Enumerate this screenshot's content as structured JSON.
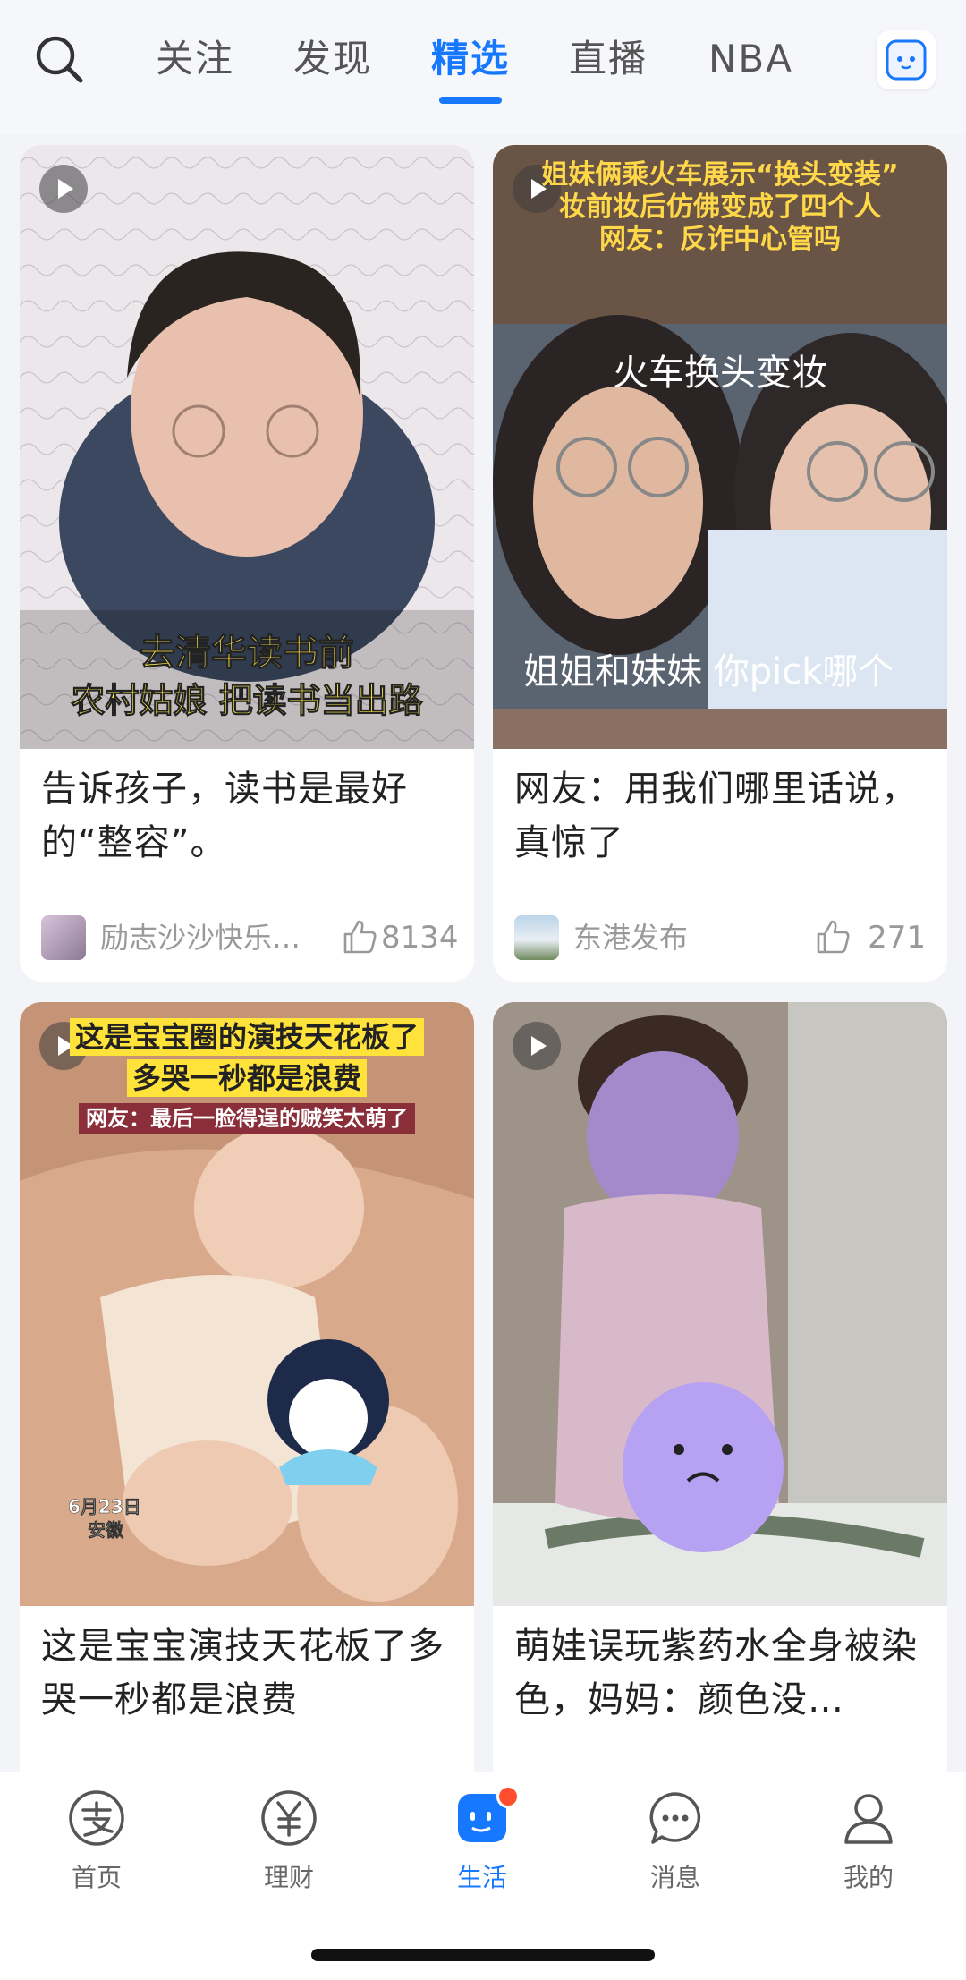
{
  "top_tabs": {
    "items": [
      "关注",
      "发现",
      "精选",
      "直播",
      "NBA"
    ],
    "active": "精选"
  },
  "cards": [
    {
      "overlay": [
        "去清华读书前",
        "农村姑娘 把读书当出路"
      ],
      "title": "告诉孩子，读书是最好的“整容”。",
      "author": "励志沙沙快乐…",
      "likes": "8134"
    },
    {
      "overlay": [
        "姐妹俩乘火车展示“换头变装”",
        "妆前妆后仿佛变成了四个人",
        "网友：反诈中心管吗",
        "火车换头变妆",
        "姐姐和妹妹 你pick哪个"
      ],
      "title": "网友：用我们哪里话说，真惊了",
      "author": "东港发布",
      "likes": "271"
    },
    {
      "overlay": [
        "这是宝宝圈的演技天花板了",
        "多哭一秒都是浪费",
        "网友：最后一脸得逞的贼笑太萌了",
        "6月23日",
        "安徽"
      ],
      "title": "这是宝宝演技天花板了多哭一秒都是浪费",
      "author": "",
      "likes": ""
    },
    {
      "overlay": [],
      "title": "萌娃误玩紫药水全身被染色，妈妈：颜色没…",
      "author": "",
      "likes": ""
    }
  ],
  "bottom_nav": {
    "items": [
      "首页",
      "理财",
      "生活",
      "消息",
      "我的"
    ],
    "active": "生活"
  },
  "colors": {
    "accent": "#1677ff",
    "badge": "#ff4d2d"
  }
}
